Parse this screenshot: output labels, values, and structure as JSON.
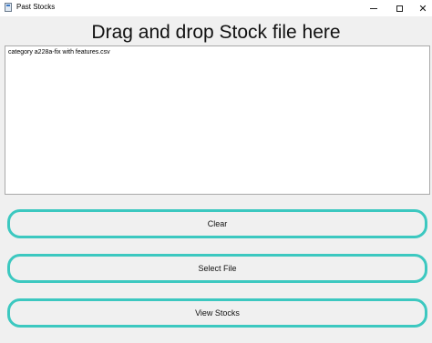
{
  "window": {
    "title": "Past Stocks",
    "close_glyph": "✕"
  },
  "heading": "Drag and drop Stock file here",
  "drop_area": {
    "files": [
      "category a228a-fix with features.csv"
    ]
  },
  "buttons": {
    "clear": "Clear",
    "select_file": "Select File",
    "view_stocks": "View Stocks"
  },
  "colors": {
    "button_border": "#3cc8c0",
    "background": "#f0f0f0"
  }
}
